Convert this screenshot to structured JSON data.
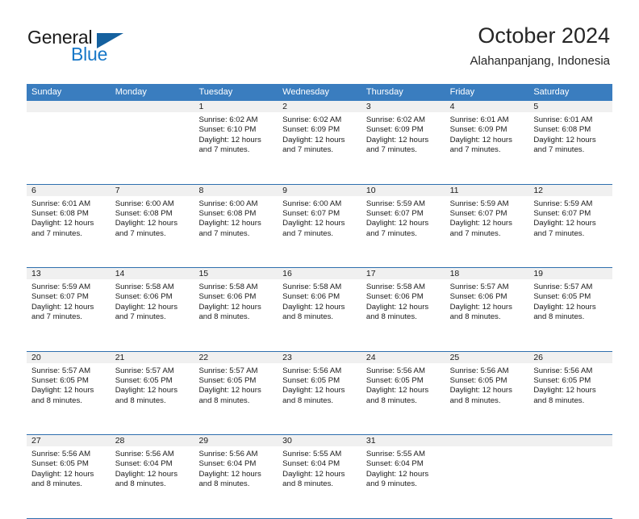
{
  "brand": {
    "name_part1": "General",
    "name_part2": "Blue",
    "accent_color": "#1878c8",
    "triangle_color": "#15619f"
  },
  "header": {
    "title": "October 2024",
    "subtitle": "Alahanpanjang, Indonesia"
  },
  "theme": {
    "header_bg": "#3a7dbf",
    "header_text": "#ffffff",
    "row_rule": "#2f6fae",
    "daynum_band_bg": "#f0f0f0",
    "text": "#1b1b1b"
  },
  "weekdays": [
    "Sunday",
    "Monday",
    "Tuesday",
    "Wednesday",
    "Thursday",
    "Friday",
    "Saturday"
  ],
  "weeks": [
    [
      {
        "day": "",
        "lines": []
      },
      {
        "day": "",
        "lines": []
      },
      {
        "day": "1",
        "lines": [
          "Sunrise: 6:02 AM",
          "Sunset: 6:10 PM",
          "Daylight: 12 hours",
          "and 7 minutes."
        ]
      },
      {
        "day": "2",
        "lines": [
          "Sunrise: 6:02 AM",
          "Sunset: 6:09 PM",
          "Daylight: 12 hours",
          "and 7 minutes."
        ]
      },
      {
        "day": "3",
        "lines": [
          "Sunrise: 6:02 AM",
          "Sunset: 6:09 PM",
          "Daylight: 12 hours",
          "and 7 minutes."
        ]
      },
      {
        "day": "4",
        "lines": [
          "Sunrise: 6:01 AM",
          "Sunset: 6:09 PM",
          "Daylight: 12 hours",
          "and 7 minutes."
        ]
      },
      {
        "day": "5",
        "lines": [
          "Sunrise: 6:01 AM",
          "Sunset: 6:08 PM",
          "Daylight: 12 hours",
          "and 7 minutes."
        ]
      }
    ],
    [
      {
        "day": "6",
        "lines": [
          "Sunrise: 6:01 AM",
          "Sunset: 6:08 PM",
          "Daylight: 12 hours",
          "and 7 minutes."
        ]
      },
      {
        "day": "7",
        "lines": [
          "Sunrise: 6:00 AM",
          "Sunset: 6:08 PM",
          "Daylight: 12 hours",
          "and 7 minutes."
        ]
      },
      {
        "day": "8",
        "lines": [
          "Sunrise: 6:00 AM",
          "Sunset: 6:08 PM",
          "Daylight: 12 hours",
          "and 7 minutes."
        ]
      },
      {
        "day": "9",
        "lines": [
          "Sunrise: 6:00 AM",
          "Sunset: 6:07 PM",
          "Daylight: 12 hours",
          "and 7 minutes."
        ]
      },
      {
        "day": "10",
        "lines": [
          "Sunrise: 5:59 AM",
          "Sunset: 6:07 PM",
          "Daylight: 12 hours",
          "and 7 minutes."
        ]
      },
      {
        "day": "11",
        "lines": [
          "Sunrise: 5:59 AM",
          "Sunset: 6:07 PM",
          "Daylight: 12 hours",
          "and 7 minutes."
        ]
      },
      {
        "day": "12",
        "lines": [
          "Sunrise: 5:59 AM",
          "Sunset: 6:07 PM",
          "Daylight: 12 hours",
          "and 7 minutes."
        ]
      }
    ],
    [
      {
        "day": "13",
        "lines": [
          "Sunrise: 5:59 AM",
          "Sunset: 6:07 PM",
          "Daylight: 12 hours",
          "and 7 minutes."
        ]
      },
      {
        "day": "14",
        "lines": [
          "Sunrise: 5:58 AM",
          "Sunset: 6:06 PM",
          "Daylight: 12 hours",
          "and 7 minutes."
        ]
      },
      {
        "day": "15",
        "lines": [
          "Sunrise: 5:58 AM",
          "Sunset: 6:06 PM",
          "Daylight: 12 hours",
          "and 8 minutes."
        ]
      },
      {
        "day": "16",
        "lines": [
          "Sunrise: 5:58 AM",
          "Sunset: 6:06 PM",
          "Daylight: 12 hours",
          "and 8 minutes."
        ]
      },
      {
        "day": "17",
        "lines": [
          "Sunrise: 5:58 AM",
          "Sunset: 6:06 PM",
          "Daylight: 12 hours",
          "and 8 minutes."
        ]
      },
      {
        "day": "18",
        "lines": [
          "Sunrise: 5:57 AM",
          "Sunset: 6:06 PM",
          "Daylight: 12 hours",
          "and 8 minutes."
        ]
      },
      {
        "day": "19",
        "lines": [
          "Sunrise: 5:57 AM",
          "Sunset: 6:05 PM",
          "Daylight: 12 hours",
          "and 8 minutes."
        ]
      }
    ],
    [
      {
        "day": "20",
        "lines": [
          "Sunrise: 5:57 AM",
          "Sunset: 6:05 PM",
          "Daylight: 12 hours",
          "and 8 minutes."
        ]
      },
      {
        "day": "21",
        "lines": [
          "Sunrise: 5:57 AM",
          "Sunset: 6:05 PM",
          "Daylight: 12 hours",
          "and 8 minutes."
        ]
      },
      {
        "day": "22",
        "lines": [
          "Sunrise: 5:57 AM",
          "Sunset: 6:05 PM",
          "Daylight: 12 hours",
          "and 8 minutes."
        ]
      },
      {
        "day": "23",
        "lines": [
          "Sunrise: 5:56 AM",
          "Sunset: 6:05 PM",
          "Daylight: 12 hours",
          "and 8 minutes."
        ]
      },
      {
        "day": "24",
        "lines": [
          "Sunrise: 5:56 AM",
          "Sunset: 6:05 PM",
          "Daylight: 12 hours",
          "and 8 minutes."
        ]
      },
      {
        "day": "25",
        "lines": [
          "Sunrise: 5:56 AM",
          "Sunset: 6:05 PM",
          "Daylight: 12 hours",
          "and 8 minutes."
        ]
      },
      {
        "day": "26",
        "lines": [
          "Sunrise: 5:56 AM",
          "Sunset: 6:05 PM",
          "Daylight: 12 hours",
          "and 8 minutes."
        ]
      }
    ],
    [
      {
        "day": "27",
        "lines": [
          "Sunrise: 5:56 AM",
          "Sunset: 6:05 PM",
          "Daylight: 12 hours",
          "and 8 minutes."
        ]
      },
      {
        "day": "28",
        "lines": [
          "Sunrise: 5:56 AM",
          "Sunset: 6:04 PM",
          "Daylight: 12 hours",
          "and 8 minutes."
        ]
      },
      {
        "day": "29",
        "lines": [
          "Sunrise: 5:56 AM",
          "Sunset: 6:04 PM",
          "Daylight: 12 hours",
          "and 8 minutes."
        ]
      },
      {
        "day": "30",
        "lines": [
          "Sunrise: 5:55 AM",
          "Sunset: 6:04 PM",
          "Daylight: 12 hours",
          "and 8 minutes."
        ]
      },
      {
        "day": "31",
        "lines": [
          "Sunrise: 5:55 AM",
          "Sunset: 6:04 PM",
          "Daylight: 12 hours",
          "and 9 minutes."
        ]
      },
      {
        "day": "",
        "lines": []
      },
      {
        "day": "",
        "lines": []
      }
    ]
  ]
}
